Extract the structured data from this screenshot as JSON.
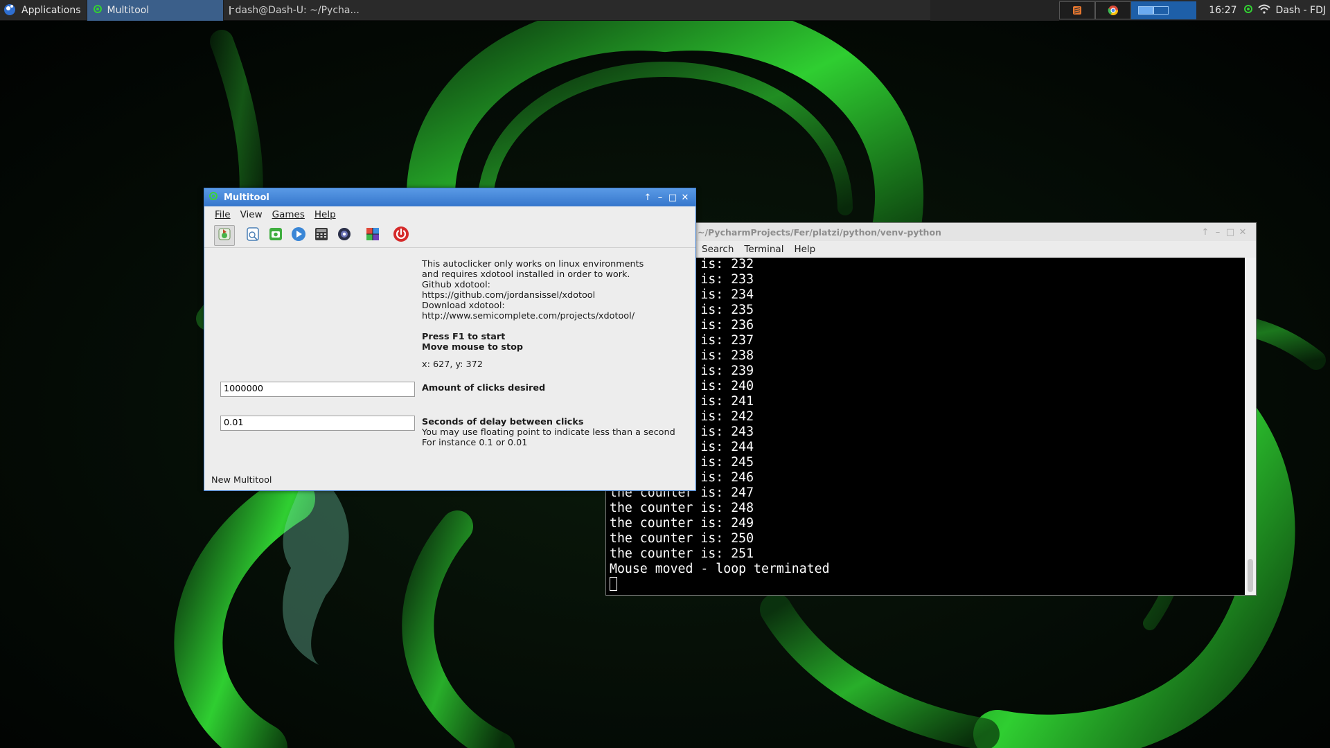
{
  "desktop": {
    "accent_color": "#2bd12b"
  },
  "panel": {
    "applications_label": "Applications",
    "tasks": [
      {
        "label": "Multitool",
        "active": true
      },
      {
        "label": "dash@Dash-U: ~/Pycha...",
        "active": false
      }
    ],
    "clock": "16:27",
    "user": "Dash - FDJ"
  },
  "multitool": {
    "title": "Multitool",
    "menu": [
      "File",
      "View",
      "Games",
      "Help"
    ],
    "toolbar_icons": [
      "autoclicker-icon",
      "clipboard-icon",
      "camera-icon",
      "play-icon",
      "calculator-icon",
      "webcam-icon",
      "cube-game-icon",
      "power-icon"
    ],
    "info_lines": [
      "This autoclicker only works on linux environments",
      "and requires xdotool installed in order to work.",
      "Github xdotool:",
      "https://github.com/jordansissel/xdotool",
      "Download xdotool:",
      "http://www.semicomplete.com/projects/xdotool/"
    ],
    "press_start": "Press F1 to start",
    "move_stop": "Move mouse to stop",
    "coords": "x: 627,  y: 372",
    "clicks_value": "1000000",
    "clicks_label": "Amount of clicks desired",
    "delay_value": "0.01",
    "delay_label": "Seconds of delay between clicks",
    "delay_hint_1": "You may use floating point to indicate less than a second",
    "delay_hint_2": "For instance 0.1 or 0.01",
    "status": "New Multitool"
  },
  "terminal": {
    "title": "~/PycharmProjects/Fer/platzi/python/venv-python",
    "menu": [
      "Search",
      "Terminal",
      "Help"
    ],
    "lines": [
      "the counter is: 232",
      "the counter is: 233",
      "the counter is: 234",
      "the counter is: 235",
      "the counter is: 236",
      "the counter is: 237",
      "the counter is: 238",
      "the counter is: 239",
      "the counter is: 240",
      "the counter is: 241",
      "the counter is: 242",
      "the counter is: 243",
      "the counter is: 244",
      "the counter is: 245",
      "the counter is: 246",
      "the counter is: 247",
      "the counter is: 248",
      "the counter is: 249",
      "the counter is: 250",
      "the counter is: 251",
      "Mouse moved - loop terminated"
    ]
  }
}
